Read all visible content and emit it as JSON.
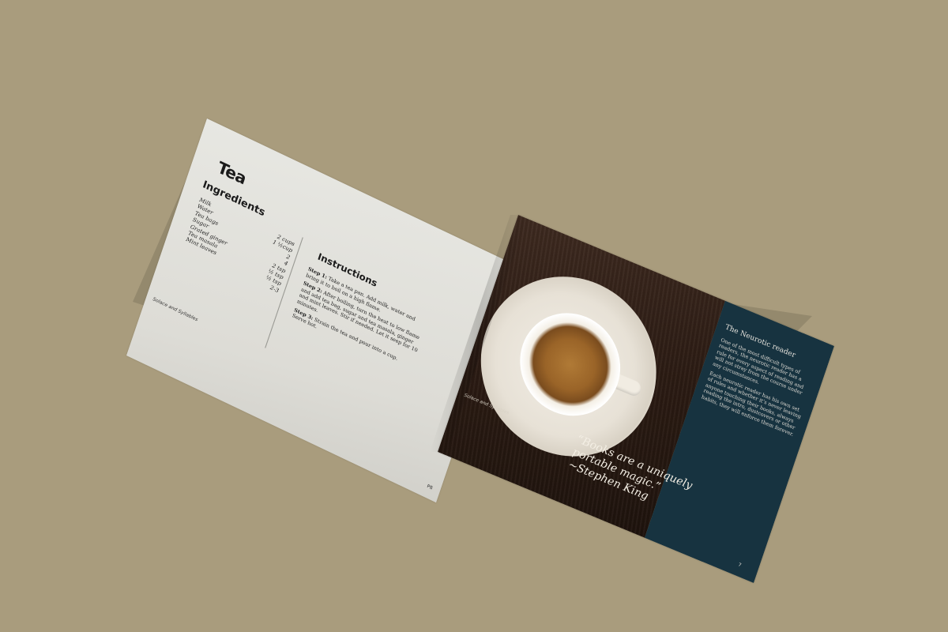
{
  "colors": {
    "background": "#a99c7d",
    "left_page": "#e0dfd9",
    "panel": "#173340",
    "wood": "#2b1b13"
  },
  "left_page": {
    "title": "Tea",
    "ingredients_heading": "Ingredients",
    "ingredients": [
      {
        "name": "Milk",
        "qty": "2 cups"
      },
      {
        "name": "Water",
        "qty": "1 ½cup"
      },
      {
        "name": "Tea bags",
        "qty": "2"
      },
      {
        "name": "Sugar",
        "qty": "4"
      },
      {
        "name": "Grated ginger",
        "qty": "2 tsp"
      },
      {
        "name": "Tea masala",
        "qty": "½ tsp"
      },
      {
        "name": "Mint leaves",
        "qty": "½ tsp"
      },
      {
        "name": "",
        "qty": "2-3"
      }
    ],
    "instructions_heading": "Instructions",
    "steps": [
      {
        "label": "Step 1:",
        "text": "Take a tea pan. Add milk, water and bring it to boil on a high flame."
      },
      {
        "label": "Step 2:",
        "text": "After boiling, turn the heat to low flame and add tea bag, sugar and tea masala, ginger and mint leaves. Stir if needed. Let it seep for 10 minutes."
      },
      {
        "label": "Step 3:",
        "text": "Strain the tea and pour into a cup. Serve hot."
      }
    ],
    "footer": "Solace and Syllables",
    "page_number": "P8"
  },
  "right_page": {
    "quote_line1": "“Books are a uniquely",
    "quote_line2": "portable magic.”",
    "quote_author": "~Stephen King",
    "footer": "Solace and Syllables",
    "panel_heading": "The Neurotic reader",
    "panel_para1": "One of the most difficult types of readers, the neurotic reader has a rule for every aspect of reading and will not stray from the course under any circumstances.",
    "panel_para2": "Each neurotic reader has his own set of rules and whether it’s never leaving anyone touching their books, always reading the intro, dustcovers or other habits, they will enforce them forever.",
    "page_number": "7"
  }
}
